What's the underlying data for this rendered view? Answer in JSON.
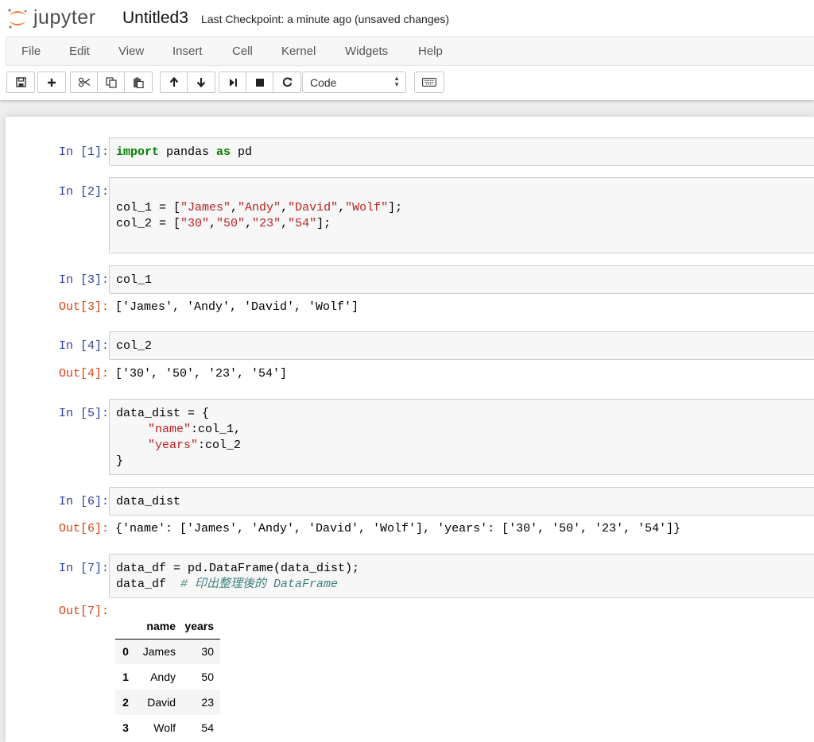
{
  "app": {
    "logo_text": "jupyter",
    "notebook_name": "Untitled3",
    "checkpoint": "Last Checkpoint: a minute ago (unsaved changes)"
  },
  "menu": [
    "File",
    "Edit",
    "View",
    "Insert",
    "Cell",
    "Kernel",
    "Widgets",
    "Help"
  ],
  "toolbar": {
    "cell_type": "Code",
    "icons": [
      "save-icon",
      "plus-icon",
      "cut-icon",
      "copy-icon",
      "paste-icon",
      "arrow-up-icon",
      "arrow-down-icon",
      "run-icon",
      "stop-icon",
      "restart-icon",
      "keyboard-icon"
    ]
  },
  "cells": {
    "c1": {
      "prompt": "In [1]:",
      "code": [
        "import",
        " pandas ",
        "as",
        " pd"
      ]
    },
    "c2": {
      "prompt": "In [2]:",
      "line1": [
        "col_1 = [",
        "\"James\"",
        ",",
        "\"Andy\"",
        ",",
        "\"David\"",
        ",",
        "\"Wolf\"",
        "];"
      ],
      "line2": [
        "col_2 = [",
        "\"30\"",
        ",",
        "\"50\"",
        ",",
        "\"23\"",
        ",",
        "\"54\"",
        "];"
      ]
    },
    "c3": {
      "prompt": "In [3]:",
      "code": "col_1",
      "out_prompt": "Out[3]:",
      "output": "['James', 'Andy', 'David', 'Wolf']"
    },
    "c4": {
      "prompt": "In [4]:",
      "code": "col_2",
      "out_prompt": "Out[4]:",
      "output": "['30', '50', '23', '54']"
    },
    "c5": {
      "prompt": "In [5]:",
      "line1": "data_dist = {",
      "name_key": "\"name\"",
      "name_val": ":col_1,",
      "years_key": "\"years\"",
      "years_val": ":col_2",
      "line4": "}"
    },
    "c6": {
      "prompt": "In [6]:",
      "code": "data_dist",
      "out_prompt": "Out[6]:",
      "output": "{'name': ['James', 'Andy', 'David', 'Wolf'], 'years': ['30', '50', '23', '54']}"
    },
    "c7": {
      "prompt": "In [7]:",
      "line1": "data_df = pd.DataFrame(data_dist);",
      "line2_code": "data_df  ",
      "line2_comment": "# 印出整理後的 DataFrame",
      "out_prompt": "Out[7]:"
    }
  },
  "dataframe": {
    "columns": [
      "name",
      "years"
    ],
    "rows": [
      {
        "index": "0",
        "name": "James",
        "years": "30"
      },
      {
        "index": "1",
        "name": "Andy",
        "years": "50"
      },
      {
        "index": "2",
        "name": "David",
        "years": "23"
      },
      {
        "index": "3",
        "name": "Wolf",
        "years": "54"
      }
    ]
  },
  "colors": {
    "in_prompt": "#303f9f",
    "out_prompt": "#d84315",
    "keyword": "#008000",
    "string": "#ba2121",
    "comment": "#408080",
    "logo_orange": "#f37726"
  }
}
